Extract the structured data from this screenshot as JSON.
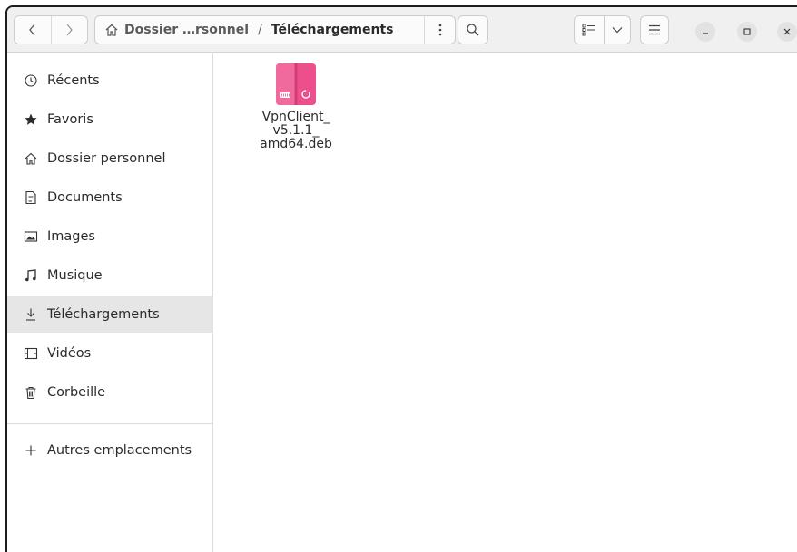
{
  "header": {
    "path": {
      "home_label": "Dossier …rsonnel",
      "separator": "/",
      "current": "Téléchargements"
    }
  },
  "sidebar": {
    "items": [
      {
        "label": "Récents",
        "icon": "clock-icon"
      },
      {
        "label": "Favoris",
        "icon": "star-icon"
      },
      {
        "label": "Dossier personnel",
        "icon": "home-icon"
      },
      {
        "label": "Documents",
        "icon": "document-icon"
      },
      {
        "label": "Images",
        "icon": "image-icon"
      },
      {
        "label": "Musique",
        "icon": "music-icon"
      },
      {
        "label": "Téléchargements",
        "icon": "download-icon",
        "active": true
      },
      {
        "label": "Vidéos",
        "icon": "film-icon"
      },
      {
        "label": "Corbeille",
        "icon": "trash-icon"
      }
    ],
    "other_locations": {
      "label": "Autres emplacements",
      "icon": "plus-icon"
    }
  },
  "content": {
    "files": [
      {
        "name": "VpnClient_\nv5.1.1_\namd64.deb",
        "icon": "deb-package-icon"
      }
    ]
  },
  "colors": {
    "deb_icon": "#ec4f8c",
    "active_item_bg": "#e6e6e6"
  }
}
